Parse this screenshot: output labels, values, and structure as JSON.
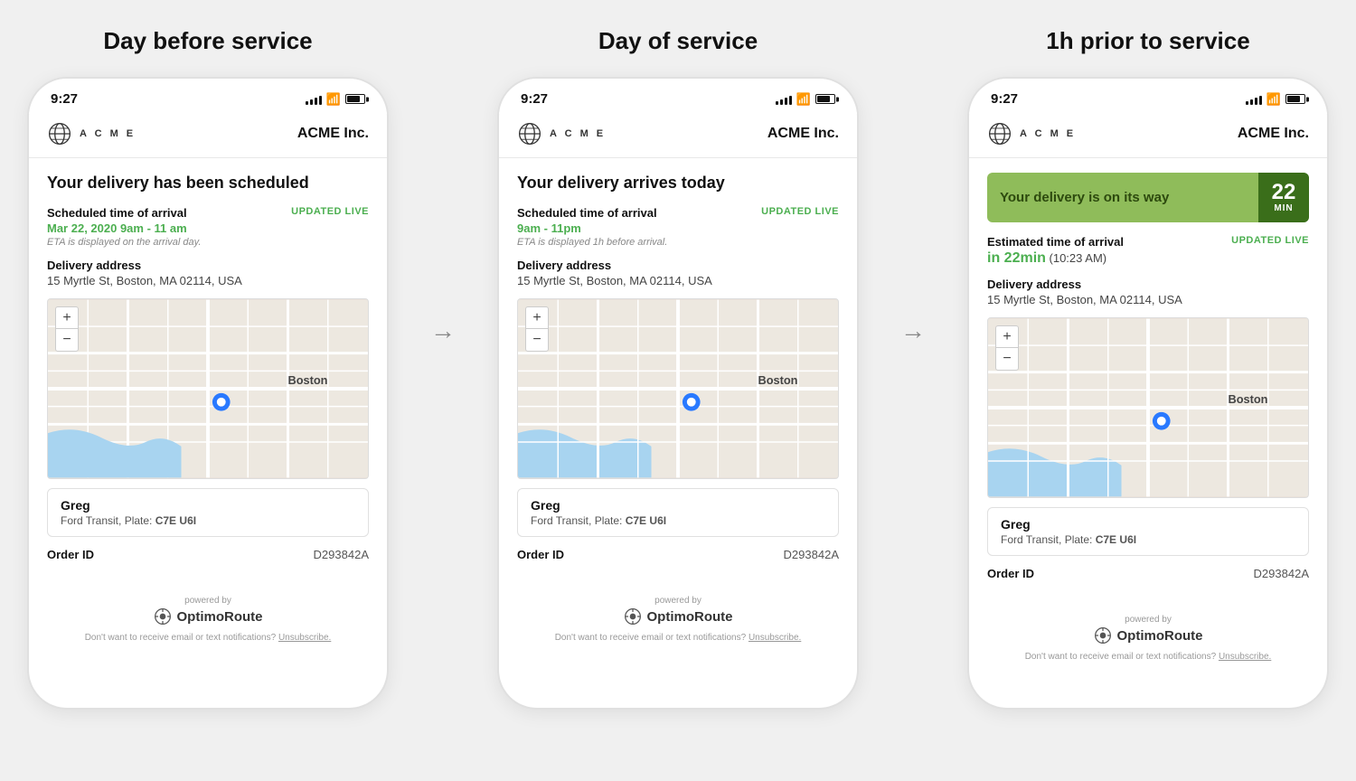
{
  "sections": [
    {
      "id": "day-before",
      "title": "Day before service",
      "phone": {
        "status_time": "9:27",
        "header": {
          "acme_letters": "A C M E",
          "acme_inc": "ACME Inc."
        },
        "delivery_title": "Your delivery has been scheduled",
        "scheduled_label": "Scheduled time of arrival",
        "scheduled_value": "Mar 22, 2020  9am - 11 am",
        "updated_live": "UPDATED LIVE",
        "eta_note": "ETA is displayed on the arrival day.",
        "address_label": "Delivery address",
        "address_value": "15 Myrtle St, Boston, MA 02114, USA",
        "driver_name": "Greg",
        "driver_vehicle": "Ford Transit, Plate: ",
        "driver_plate": "C7E U6I",
        "order_label": "Order ID",
        "order_value": "D293842A",
        "powered_by": "powered by",
        "optimoroute": "OptimoRoute",
        "unsubscribe_text": "Don't want to receive email or text notifications?",
        "unsubscribe_link": "Unsubscribe."
      }
    },
    {
      "id": "day-of",
      "title": "Day of service",
      "phone": {
        "status_time": "9:27",
        "header": {
          "acme_letters": "A C M E",
          "acme_inc": "ACME Inc."
        },
        "delivery_title": "Your delivery arrives today",
        "scheduled_label": "Scheduled time of arrival",
        "scheduled_value": "9am - 11pm",
        "updated_live": "UPDATED LIVE",
        "eta_note": "ETA is displayed 1h before arrival.",
        "address_label": "Delivery address",
        "address_value": "15 Myrtle St, Boston, MA 02114, USA",
        "driver_name": "Greg",
        "driver_vehicle": "Ford Transit, Plate: ",
        "driver_plate": "C7E U6I",
        "order_label": "Order ID",
        "order_value": "D293842A",
        "powered_by": "powered by",
        "optimoroute": "OptimoRoute",
        "unsubscribe_text": "Don't want to receive email or text notifications?",
        "unsubscribe_link": "Unsubscribe."
      }
    },
    {
      "id": "one-hour-prior",
      "title": "1h prior to service",
      "phone": {
        "status_time": "9:27",
        "header": {
          "acme_letters": "A C M E",
          "acme_inc": "ACME Inc."
        },
        "banner_text": "Your delivery is on its way",
        "banner_number": "22",
        "banner_min": "MIN",
        "eta_label": "Estimated time of arrival",
        "eta_value_green": "in 22min",
        "eta_value": " (10:23 AM)",
        "updated_live": "UPDATED LIVE",
        "address_label": "Delivery address",
        "address_value": "15 Myrtle St, Boston, MA 02114, USA",
        "driver_name": "Greg",
        "driver_vehicle": "Ford Transit, Plate: ",
        "driver_plate": "C7E U6I",
        "order_label": "Order ID",
        "order_value": "D293842A",
        "powered_by": "powered by",
        "optimoroute": "OptimoRoute",
        "unsubscribe_text": "Don't want to receive email or text notifications?",
        "unsubscribe_link": "Unsubscribe."
      }
    }
  ],
  "arrow": "→",
  "map_plus": "+",
  "map_minus": "−"
}
